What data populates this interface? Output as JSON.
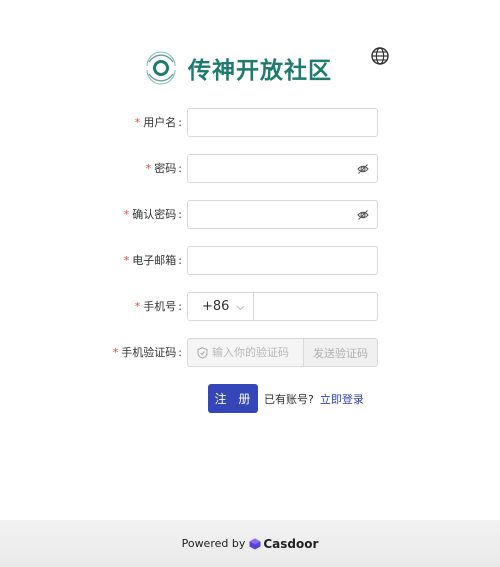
{
  "brand": {
    "name": "传神开放社区",
    "color": "#1e7b6e"
  },
  "language_icon": "globe-icon",
  "form": {
    "required_mark": "*",
    "username": {
      "label": "用户名",
      "value": "",
      "placeholder": ""
    },
    "password": {
      "label": "密码",
      "value": "",
      "placeholder": "",
      "icon": "eye-off-icon"
    },
    "confirm": {
      "label": "确认密码",
      "value": "",
      "placeholder": "",
      "icon": "eye-off-icon"
    },
    "email": {
      "label": "电子邮箱",
      "value": "",
      "placeholder": ""
    },
    "phone": {
      "label": "手机号",
      "country_code": "+86",
      "value": "",
      "placeholder": ""
    },
    "code": {
      "label": "手机验证码",
      "placeholder": "输入你的验证码",
      "send_button": "发送验证码",
      "icon": "shield-icon"
    }
  },
  "actions": {
    "register": "注 册",
    "have_account": "已有账号?",
    "login_now": "立即登录",
    "accent": "#3446b8"
  },
  "footer": {
    "powered": "Powered by",
    "vendor": "Casdoor"
  }
}
